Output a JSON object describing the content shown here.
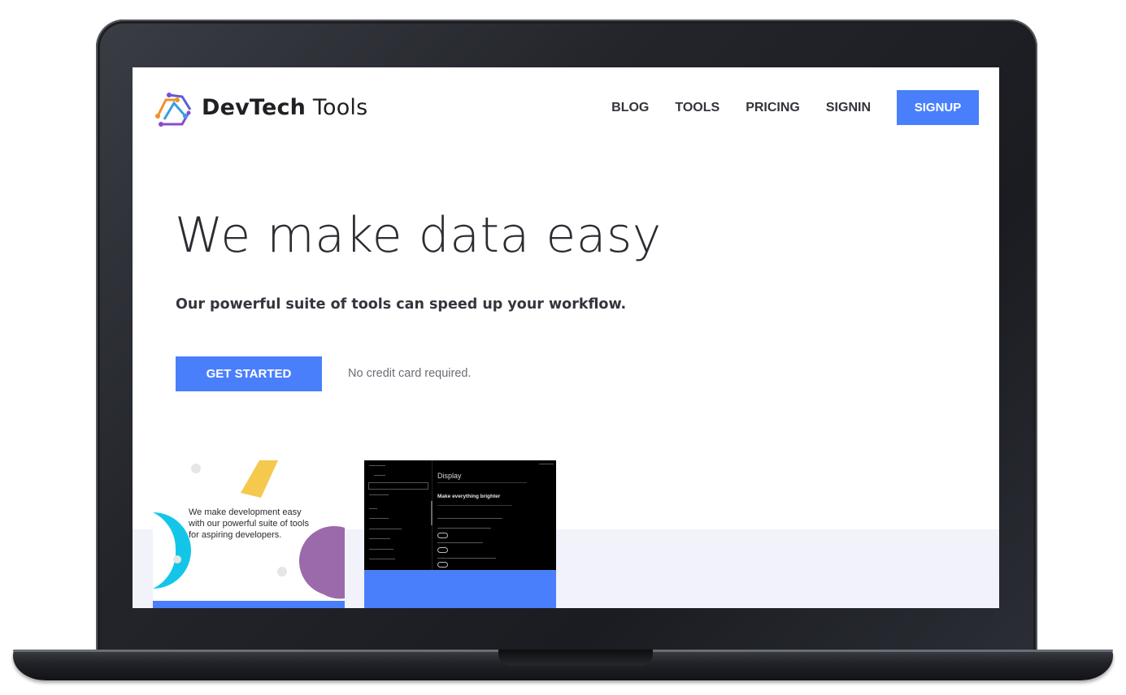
{
  "brand": {
    "name_bold": "DevTech",
    "name_rest": " Tools",
    "logo_icon": "devtech-logo-icon"
  },
  "nav": {
    "links": [
      "BLOG",
      "TOOLS",
      "PRICING",
      "SIGNIN"
    ],
    "signup_label": "SIGNUP"
  },
  "hero": {
    "title": "We make data easy",
    "subtitle": "Our powerful suite of tools can speed up your workflow.",
    "cta_label": "GET STARTED",
    "note": "No credit card required."
  },
  "cards": {
    "card1_text": "We make development easy with our powerful suite of tools for aspiring developers.",
    "card2_window_title": "Display",
    "card2_heading": "Make everything brighter"
  },
  "colors": {
    "accent": "#4a7ffc",
    "band": "#f1f2fa",
    "cyan": "#13c6e8",
    "purple": "#9b6aab",
    "yellow": "#f5c84e"
  }
}
